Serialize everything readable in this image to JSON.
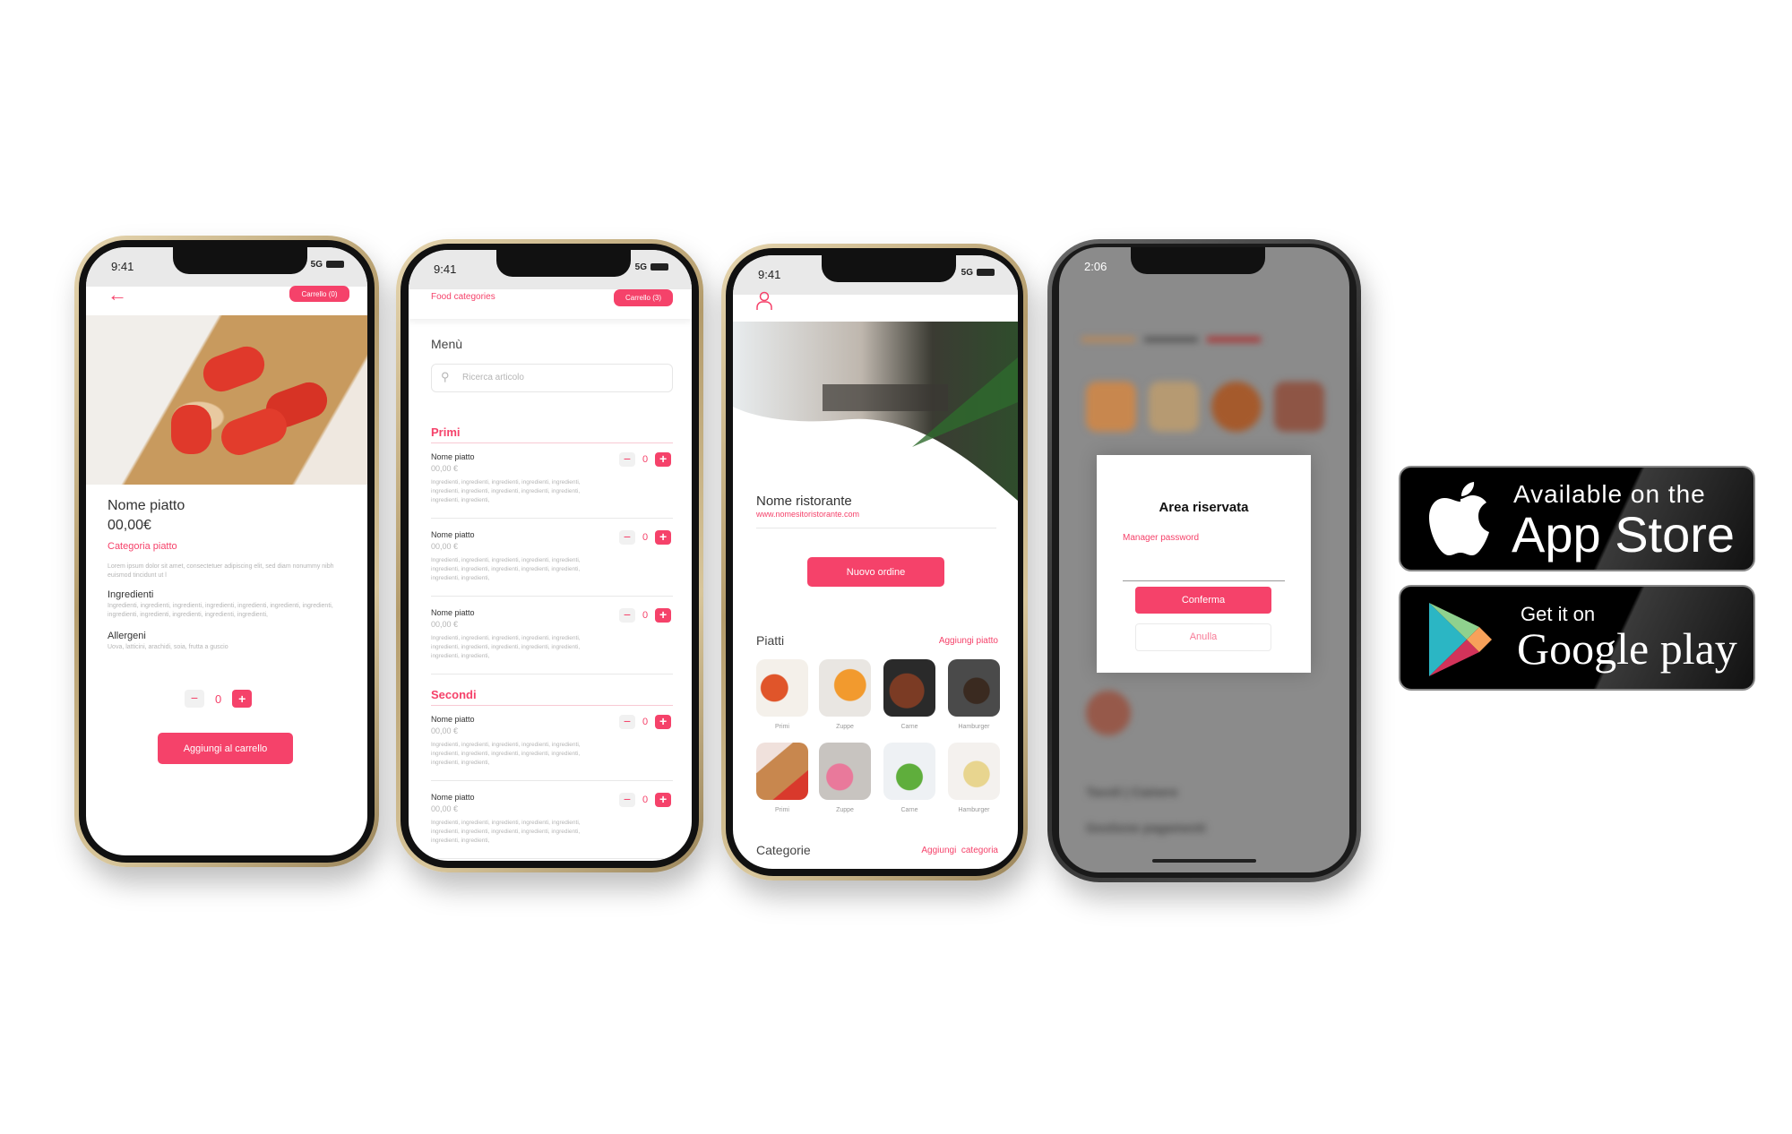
{
  "colors": {
    "accent": "#f5426a",
    "phone_frame": "#c9b58a"
  },
  "phone1": {
    "time": "9:41",
    "signal": "5G",
    "back_icon": "arrow-left-icon",
    "cart_label": "Carrello (0)",
    "dish_name": "Nome piatto",
    "price": "00,00€",
    "category": "Categoria piatto",
    "description": "Lorem ipsum dolor sit amet, consectetuer adipiscing elit, sed diam nonummy nibh euismod tincidunt ut l",
    "ingredients_title": "Ingredienti",
    "ingredients": "Ingredienti, ingredienti, ingredienti, ingredienti, ingredienti, ingredienti, ingredienti, ingredienti, ingredienti, ingredienti, ingredienti, ingredienti,",
    "allergens_title": "Allergeni",
    "allergens": "Uova, latticini, arachidi, soia, frutta a guscio",
    "quantity": "0",
    "add_to_cart": "Aggiungi al carrello"
  },
  "phone2": {
    "time": "9:41",
    "signal": "5G",
    "food_categories": "Food categories",
    "cart_label": "Carrello (3)",
    "title": "Menù",
    "search_placeholder": "Ricerca articolo",
    "sections": [
      {
        "name": "Primi",
        "items": [
          {
            "name": "Nome piatto",
            "price": "00,00 €",
            "ingredients": "Ingredienti, ingredienti, ingredienti, ingredienti, ingredienti, ingredienti, ingredienti, ingredienti, ingredienti, ingredienti, ingredienti, ingredienti,",
            "qty": "0"
          },
          {
            "name": "Nome piatto",
            "price": "00,00 €",
            "ingredients": "Ingredienti, ingredienti, ingredienti, ingredienti, ingredienti, ingredienti, ingredienti, ingredienti, ingredienti, ingredienti, ingredienti, ingredienti,",
            "qty": "0"
          },
          {
            "name": "Nome piatto",
            "price": "00,00 €",
            "ingredients": "Ingredienti, ingredienti, ingredienti, ingredienti, ingredienti, ingredienti, ingredienti, ingredienti, ingredienti, ingredienti, ingredienti, ingredienti,",
            "qty": "0"
          }
        ]
      },
      {
        "name": "Secondi",
        "items": [
          {
            "name": "Nome piatto",
            "price": "00,00 €",
            "ingredients": "Ingredienti, ingredienti, ingredienti, ingredienti, ingredienti, ingredienti, ingredienti, ingredienti, ingredienti, ingredienti, ingredienti, ingredienti,",
            "qty": "0"
          },
          {
            "name": "Nome piatto",
            "price": "00,00 €",
            "ingredients": "Ingredienti, ingredienti, ingredienti, ingredienti, ingredienti, ingredienti, ingredienti, ingredienti, ingredienti, ingredienti, ingredienti, ingredienti,",
            "qty": "0"
          }
        ]
      }
    ]
  },
  "phone3": {
    "time": "9:41",
    "signal": "5G",
    "user_icon": "user-icon",
    "restaurant_name": "Nome ristorante",
    "website": "www.nomesitoristorante.com",
    "new_order": "Nuovo ordine",
    "dishes_title": "Piatti",
    "add_dish": "Aggiungi piatto",
    "dishes": [
      {
        "label": "Primi"
      },
      {
        "label": "Zuppe"
      },
      {
        "label": "Carne"
      },
      {
        "label": "Hamburger"
      },
      {
        "label": "Primi"
      },
      {
        "label": "Zuppe"
      },
      {
        "label": "Carne"
      },
      {
        "label": "Hamburger"
      }
    ],
    "categories_title": "Categorie",
    "add_category": "Aggiungi  categoria"
  },
  "phone4": {
    "time": "2:06",
    "dialog_title": "Area riservata",
    "password_label": "Manager password",
    "password_value": "",
    "confirm": "Conferma",
    "cancel": "Anulla",
    "bg_items": [
      "Tavoli | Camere",
      "Gestione pagamenti"
    ]
  },
  "badges": {
    "appstore_small": "Available on the",
    "appstore_big": "App Store",
    "google_small": "Get it on",
    "google_big": "Google play"
  }
}
